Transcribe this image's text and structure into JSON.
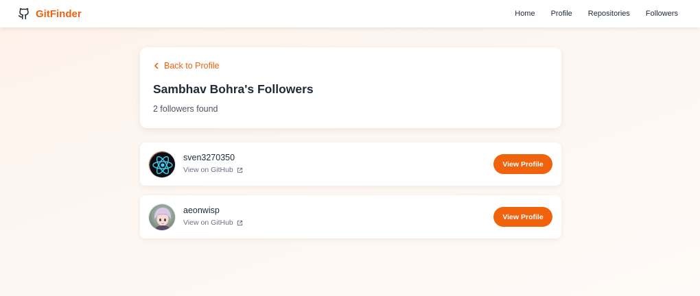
{
  "navbar": {
    "brand": "GitFinder",
    "brand_icon": "github-icon",
    "links": [
      "Home",
      "Profile",
      "Repositories",
      "Followers"
    ]
  },
  "header": {
    "back_label": "Back to Profile",
    "title": "Sambhav Bohra's Followers",
    "count_text": "2 followers found"
  },
  "followers": [
    {
      "username": "sven3270350",
      "link_label": "View on GitHub",
      "button_label": "View Profile",
      "avatar": "react-atom-avatar"
    },
    {
      "username": "aeonwisp",
      "link_label": "View on GitHub",
      "button_label": "View Profile",
      "avatar": "anime-character-avatar"
    }
  ],
  "colors": {
    "accent": "#f0620c",
    "background": "#fdf4ee"
  }
}
